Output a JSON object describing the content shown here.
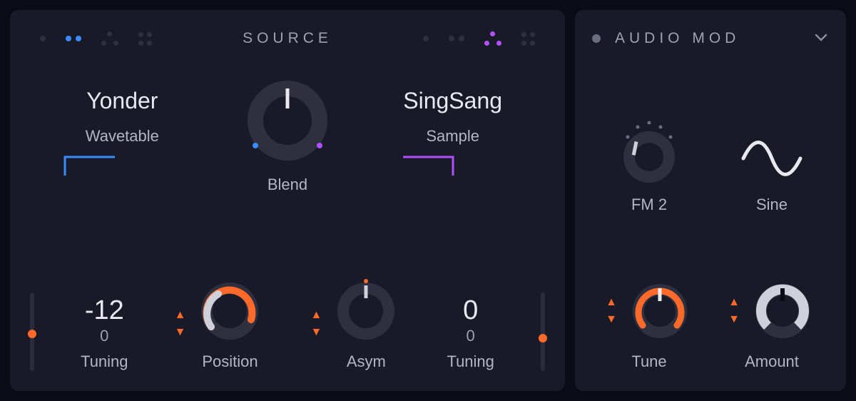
{
  "source": {
    "title": "SOURCE",
    "left": {
      "name": "Yonder",
      "type": "Wavetable"
    },
    "right": {
      "name": "SingSang",
      "type": "Sample"
    },
    "blend_label": "Blend",
    "controls": {
      "tuning_left": {
        "value": "-12",
        "fine": "0",
        "label": "Tuning"
      },
      "position": {
        "label": "Position"
      },
      "asym": {
        "label": "Asym"
      },
      "tuning_right": {
        "value": "0",
        "fine": "0",
        "label": "Tuning"
      }
    }
  },
  "audiomod": {
    "title": "AUDIO MOD",
    "fm": {
      "label": "FM 2"
    },
    "wave": {
      "label": "Sine"
    },
    "tune": {
      "label": "Tune"
    },
    "amount": {
      "label": "Amount"
    }
  },
  "colors": {
    "accent_orange": "#ff6a2a",
    "accent_blue": "#3a8cff",
    "accent_purple": "#b050ff"
  }
}
